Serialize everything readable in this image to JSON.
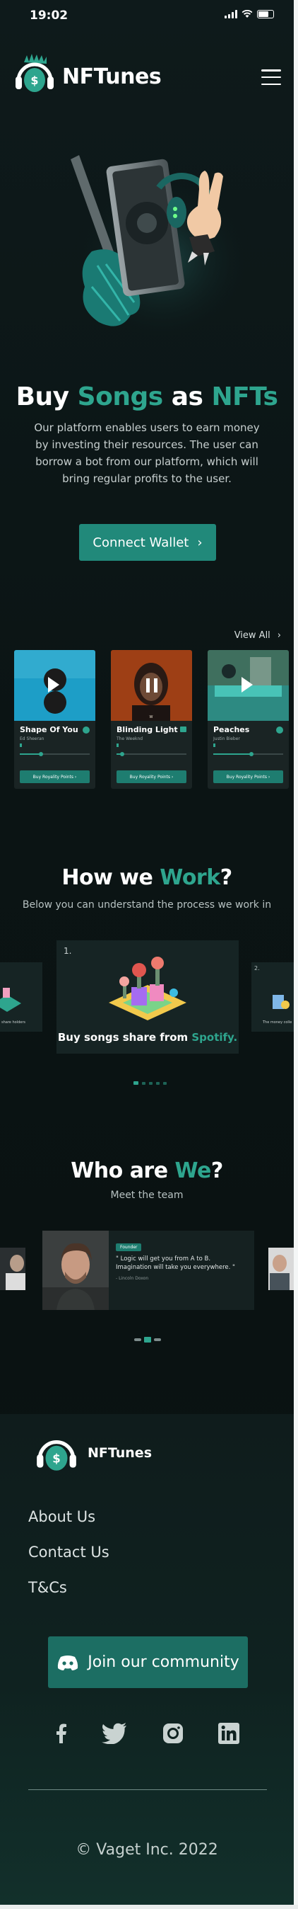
{
  "status_bar": {
    "time": "19:02"
  },
  "header": {
    "brand": "NFTunes",
    "logo_icon": "dollar-headphones-icon",
    "menu_icon": "hamburger-menu-icon"
  },
  "hero": {
    "title_part1": "Buy ",
    "title_part2": "Songs",
    "title_part3": " as ",
    "title_part4": "NFTs",
    "description": "Our platform enables users to earn money by investing their resources.  The user can borrow a bot from our platform, which will bring regular profits to the user.",
    "connect_label": "Connect Wallet"
  },
  "songs": {
    "view_all": "View All",
    "items": [
      {
        "title": "Shape Of You",
        "artist": "Ed Sheeran",
        "button": "Buy Royality Points",
        "state": "play",
        "progress": 0.3
      },
      {
        "title": "Blinding Light",
        "artist": "The Weeknd",
        "button": "Buy Royality Points",
        "state": "pause",
        "progress": 0.08
      },
      {
        "title": "Peaches",
        "artist": "Justin Bieber",
        "button": "Buy Royality Points",
        "state": "play",
        "progress": 0.55
      }
    ]
  },
  "how": {
    "title_part1": "How we ",
    "title_part2": "Work",
    "title_part3": "?",
    "subtitle": "Below you can understand the process we work in",
    "main_step": {
      "number": "1.",
      "caption_part1": "Buy songs share from ",
      "caption_part2": "Spotify."
    },
    "left_step_caption": "share holders",
    "right_step": {
      "number": "2.",
      "caption": "The money colle"
    }
  },
  "team": {
    "title_part1": "Who are ",
    "title_part2": "We",
    "title_part3": "?",
    "subtitle": "Meet the team",
    "member": {
      "tag": "Founder",
      "quote": "\" Logic will get you from A to B. Imagination will take you everywhere. \"",
      "author": "- Lincoln Doxon"
    }
  },
  "footer": {
    "brand": "NFTunes",
    "links": [
      "About Us",
      "Contact Us",
      "T&Cs"
    ],
    "community_label": "Join our community",
    "social": [
      "facebook-icon",
      "twitter-icon",
      "instagram-icon",
      "linkedin-icon"
    ],
    "copyright": "© Vaget Inc. 2022"
  },
  "colors": {
    "accent": "#2ea58e",
    "button": "#21897a",
    "background": "#0b1414"
  }
}
